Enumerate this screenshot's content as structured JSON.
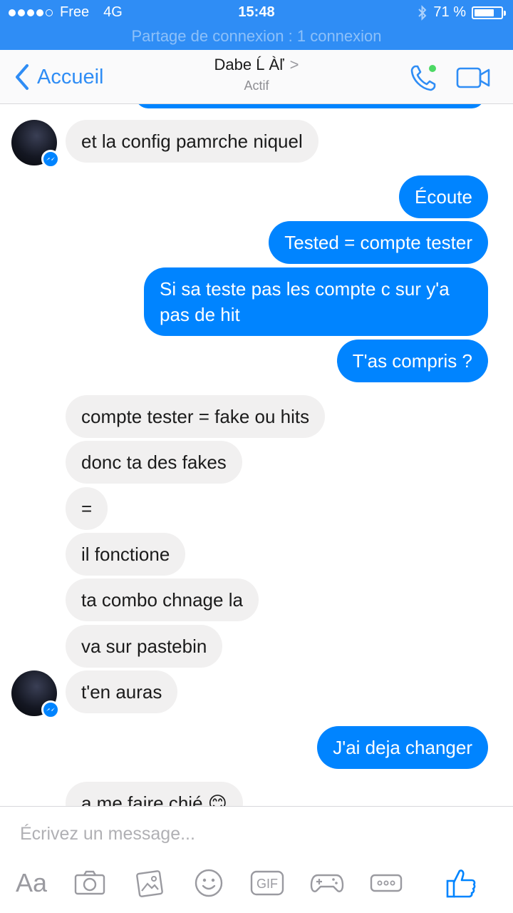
{
  "status_bar": {
    "carrier": "Free",
    "network": "4G",
    "time": "15:48",
    "battery": "71 %",
    "battery_level": 0.71,
    "hotspot_banner": "Partage de connexion : 1 connexion"
  },
  "nav": {
    "back_label": "Accueil",
    "contact_name": "Dabe Ĺ Àľ",
    "contact_chevron": ">",
    "contact_status": "Actif"
  },
  "messages": [
    {
      "dir": "in",
      "text": "et la config pamrche niquel"
    },
    {
      "dir": "out",
      "text": "Écoute"
    },
    {
      "dir": "out",
      "text": "Tested = compte tester"
    },
    {
      "dir": "out",
      "text": "Si sa teste pas les compte c sur y'a pas de hit"
    },
    {
      "dir": "out",
      "text": "T'as compris ?"
    },
    {
      "dir": "in",
      "text": "compte tester = fake ou hits"
    },
    {
      "dir": "in",
      "text": "donc ta des fakes"
    },
    {
      "dir": "in",
      "text": "="
    },
    {
      "dir": "in",
      "text": "il fonctione"
    },
    {
      "dir": "in",
      "text": "ta combo chnage la"
    },
    {
      "dir": "in",
      "text": "va sur pastebin"
    },
    {
      "dir": "in",
      "text": "t'en auras"
    },
    {
      "dir": "out",
      "text": "J'ai deja changer"
    },
    {
      "dir": "in",
      "text": "a me faire chié 😊"
    }
  ],
  "composer": {
    "placeholder": "Écrivez un message...",
    "aa_label": "Aa",
    "gif_label": "GIF"
  },
  "colors": {
    "accent": "#0084ff",
    "status_bar": "#2f8df5",
    "incoming_bubble": "#f1f0f0",
    "icon_gray": "#9a9aa0"
  }
}
